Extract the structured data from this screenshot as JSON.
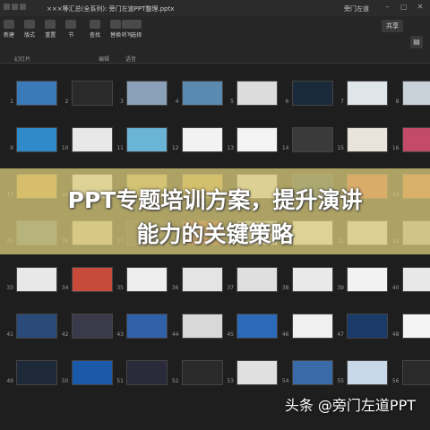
{
  "window": {
    "doc_title": "×××等汇总(全系列): 旁门左道PPT整理.pptx",
    "user_label": "旁门左道"
  },
  "toolbar": {
    "buttons": [
      {
        "label": "新建"
      },
      {
        "label": "版式"
      },
      {
        "label": "重置"
      },
      {
        "label": "节"
      },
      {
        "label": "查找"
      },
      {
        "label": "替换"
      },
      {
        "label": "选择"
      },
      {
        "label": "听写"
      }
    ],
    "group_labels": [
      "幻灯片",
      "编辑",
      "语音"
    ],
    "share_label": "共享",
    "notes_icon": "notes-icon"
  },
  "slides": {
    "numbers": [
      "1",
      "2",
      "3",
      "4",
      "5",
      "6",
      "7",
      "8",
      "9",
      "10",
      "11",
      "12",
      "13",
      "14",
      "15",
      "16",
      "17",
      "18",
      "19",
      "20",
      "21",
      "22",
      "23",
      "24",
      "25",
      "26",
      "27",
      "28",
      "29",
      "30",
      "31",
      "32",
      "33",
      "34",
      "35",
      "36",
      "37",
      "38",
      "39",
      "40",
      "41",
      "42",
      "43",
      "44",
      "45",
      "46",
      "47",
      "48",
      "49",
      "50",
      "51",
      "52",
      "53",
      "54",
      "55",
      "56"
    ],
    "colors": [
      "#3a7ab8",
      "#2a2a2a",
      "#8aa0b8",
      "#5a8ab0",
      "#dcdcdc",
      "#1a2a3a",
      "#dfe6ea",
      "#c8d0d8",
      "#2e8ac8",
      "#e8e8e8",
      "#6ab4d8",
      "#f2f2f2",
      "#f4f4f4",
      "#3a3a3a",
      "#e8e4dc",
      "#c44a6a",
      "#d89a3a",
      "#fafafa",
      "#c8b060",
      "#c8a040",
      "#f0f0f0",
      "#1a3a5a",
      "#e84a3a",
      "#e05a2a",
      "#4a6a8a",
      "#d8c8b8",
      "#2a2a2a",
      "#a03030",
      "#e0e0e0",
      "#f8f8f8",
      "#eaeaea",
      "#bcbcbc",
      "#e8e8e8",
      "#c84a3a",
      "#ededed",
      "#e4e4e4",
      "#dfdfdf",
      "#e9e9e9",
      "#f2f2f2",
      "#e8e8e8",
      "#2a4a7a",
      "#3a3a4a",
      "#3060a8",
      "#d8d8d8",
      "#2a6ab8",
      "#f0f0f0",
      "#1a3a6a",
      "#f4f4f4",
      "#1e2a3a",
      "#1a5aa8",
      "#2a2a3a",
      "#2a2a2a",
      "#e0e0e0",
      "#3a6aa8",
      "#c8d8e8",
      "#2a2a2a"
    ]
  },
  "overlay": {
    "title_line1": "PPT专题培训方案，提升演讲",
    "title_line2": "能力的关键策略"
  },
  "watermark": {
    "text": "头条 @旁门左道PPT"
  }
}
